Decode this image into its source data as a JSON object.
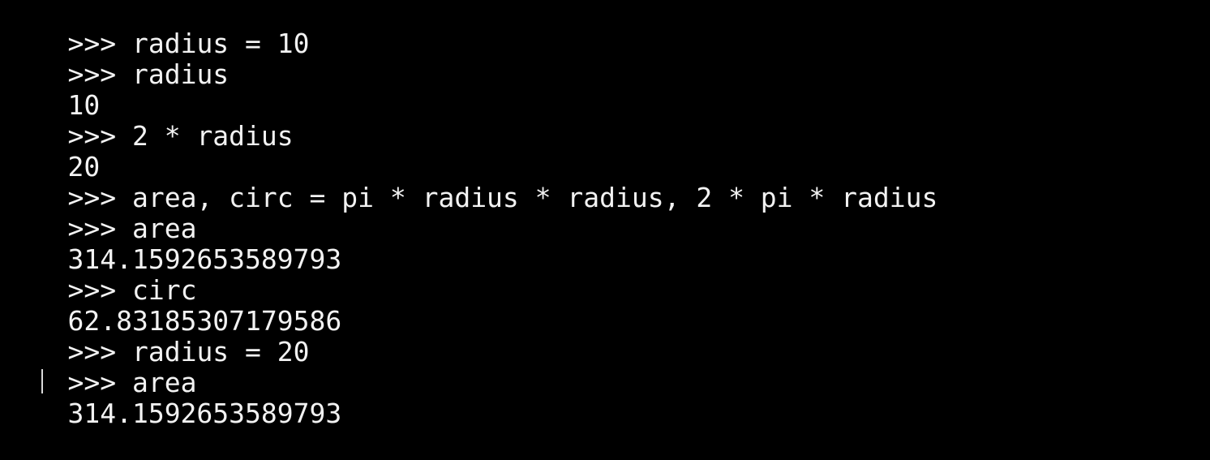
{
  "terminal": {
    "prompt": ">>> ",
    "lines": [
      {
        "type": "input",
        "text": "radius = 10"
      },
      {
        "type": "input",
        "text": "radius"
      },
      {
        "type": "output",
        "text": "10"
      },
      {
        "type": "input",
        "text": "2 * radius"
      },
      {
        "type": "output",
        "text": "20"
      },
      {
        "type": "input",
        "text": "area, circ = pi * radius * radius, 2 * pi * radius"
      },
      {
        "type": "input",
        "text": "area"
      },
      {
        "type": "output",
        "text": "314.1592653589793"
      },
      {
        "type": "input",
        "text": "circ"
      },
      {
        "type": "output",
        "text": "62.83185307179586"
      },
      {
        "type": "input",
        "text": "radius = 20"
      },
      {
        "type": "input",
        "text": "area"
      },
      {
        "type": "output",
        "text": "314.1592653589793"
      }
    ]
  },
  "colors": {
    "background": "#000000",
    "foreground": "#f2f2f2"
  }
}
